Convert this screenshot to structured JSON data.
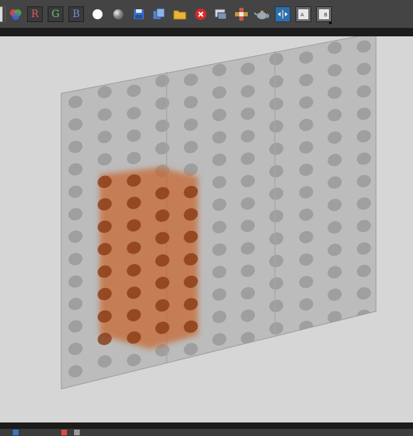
{
  "toolbar": {
    "channels": [
      {
        "label": "R",
        "color": "#e05a5a"
      },
      {
        "label": "G",
        "color": "#6ec46e"
      },
      {
        "label": "B",
        "color": "#6a8fe0"
      }
    ],
    "icons": [
      "mono-channel-icon",
      "rgb-channels-icon",
      "red-channel",
      "green-channel",
      "blue-channel",
      "white-sphere-icon",
      "grey-sphere-icon",
      "save-icon",
      "copy-icon",
      "open-folder-icon",
      "close-icon",
      "render-frame-icon",
      "transform-gizmo-icon",
      "teapot-icon",
      "compare-ab-icon",
      "show-a-icon",
      "show-b-icon"
    ]
  },
  "colors": {
    "toolbar_bg": "#444444",
    "viewport_bg": "#d6d6d6",
    "panel_tint": "#bcbcbc",
    "dot_color": "#9a9a9a",
    "box_color": "#c8662e"
  }
}
